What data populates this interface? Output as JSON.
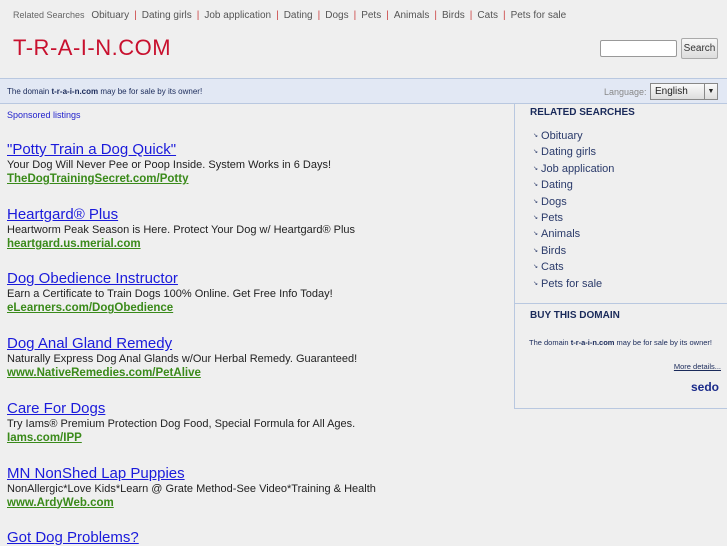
{
  "top_links": {
    "label": "Related Searches",
    "items": [
      "Obituary",
      "Dating girls",
      "Job application",
      "Dating",
      "Dogs",
      "Pets",
      "Animals",
      "Birds",
      "Cats",
      "Pets for sale"
    ]
  },
  "logo": "T-R-A-I-N.COM",
  "search": {
    "value": "",
    "button": "Search"
  },
  "band": {
    "prefix": "The domain ",
    "domain": "t-r-a-i-n.com",
    "suffix": " may be for sale by its owner!",
    "language_label": "Language:",
    "language": "English"
  },
  "sponsored": "Sponsored listings",
  "ads": [
    {
      "title": "\"Potty Train a Dog Quick\"",
      "desc": "Your Dog Will Never Pee or Poop Inside. System Works in 6 Days!",
      "url": "TheDogTrainingSecret.com/Potty"
    },
    {
      "title": "Heartgard® Plus",
      "desc": "Heartworm Peak Season is Here. Protect Your Dog w/ Heartgard® Plus",
      "url": "heartgard.us.merial.com"
    },
    {
      "title": "Dog Obedience Instructor",
      "desc": "Earn a Certificate to Train Dogs 100% Online. Get Free Info Today!",
      "url": "eLearners.com/DogObedience"
    },
    {
      "title": "Dog Anal Gland Remedy",
      "desc": "Naturally Express Dog Anal Glands w/Our Herbal Remedy. Guaranteed!",
      "url": "www.NativeRemedies.com/PetAlive"
    },
    {
      "title": "Care For Dogs",
      "desc": "Try Iams® Premium Protection Dog Food, Special Formula for All Ages.",
      "url": "Iams.com/IPP"
    },
    {
      "title": "MN NonShed Lap Puppies",
      "desc": "NonAllergic*Love Kids*Learn @ Grate Method-See Video*Training & Health",
      "url": "www.ArdyWeb.com"
    },
    {
      "title": "Got Dog Problems?"
    }
  ],
  "sidebar": {
    "related_title": "RELATED SEARCHES",
    "related": [
      "Obituary",
      "Dating girls",
      "Job application",
      "Dating",
      "Dogs",
      "Pets",
      "Animals",
      "Birds",
      "Cats",
      "Pets for sale"
    ],
    "buy_title": "BUY THIS DOMAIN",
    "buy_prefix": "The domain ",
    "buy_domain": "t-r-a-i-n.com",
    "buy_suffix": " may be for sale by its owner!",
    "more": "More details...",
    "brand": "sedo"
  }
}
